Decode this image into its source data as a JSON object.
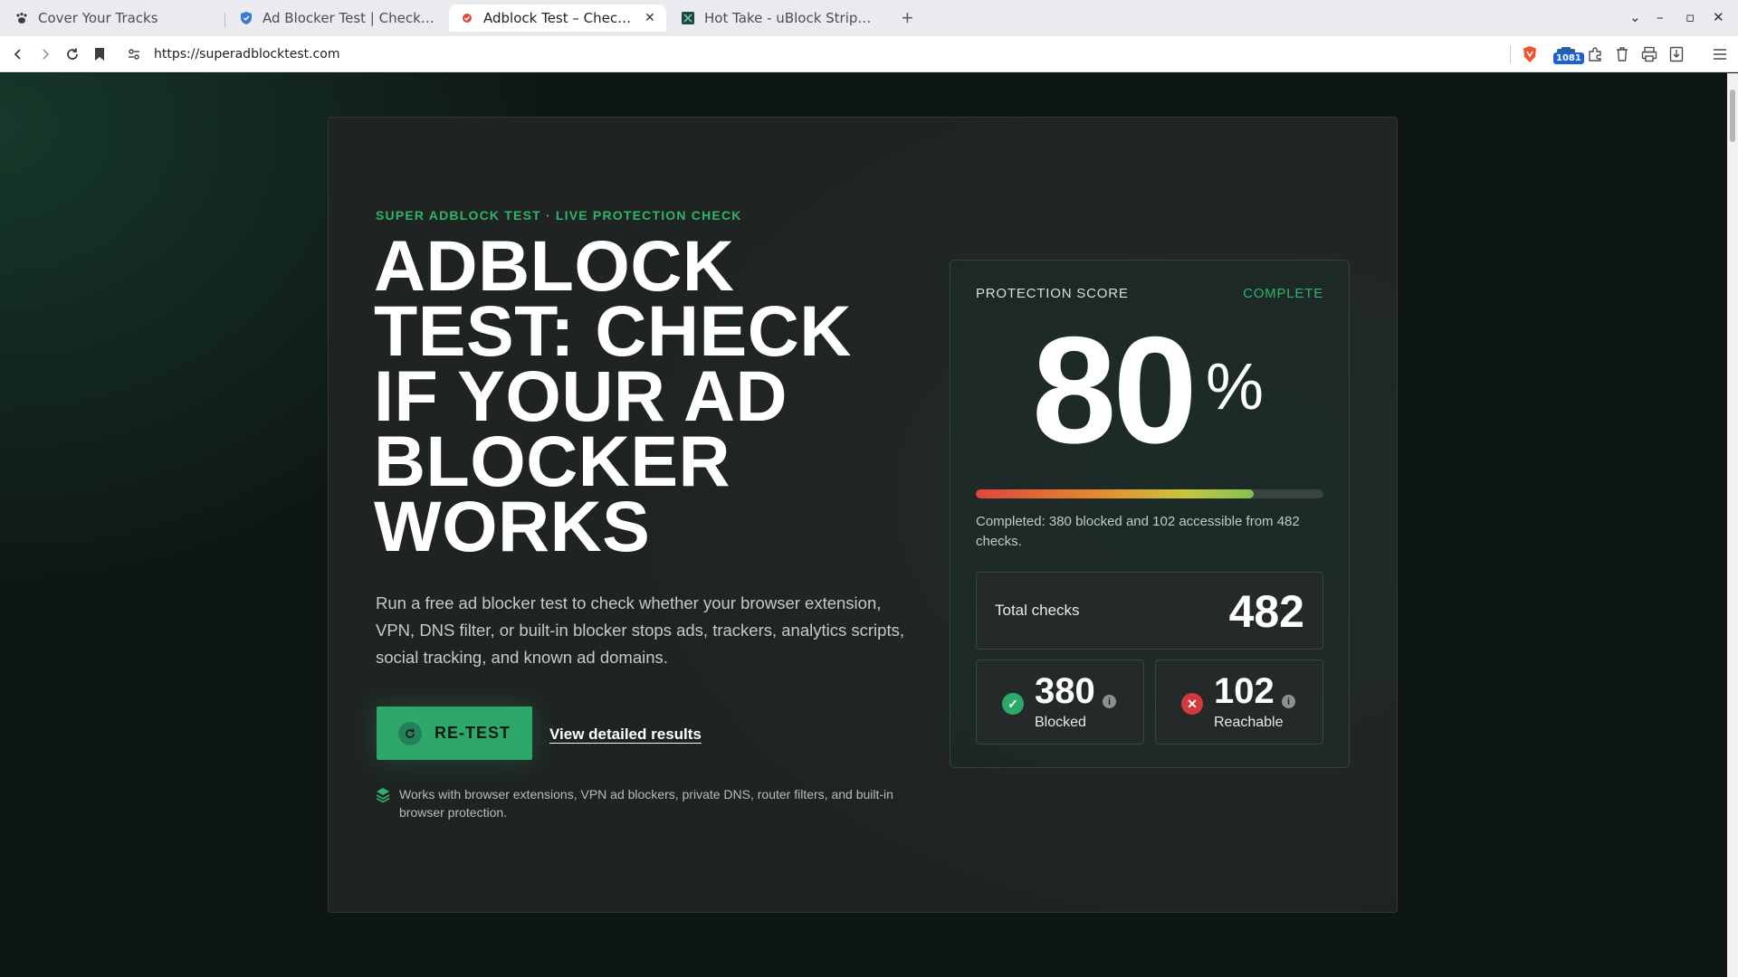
{
  "browser": {
    "tabs": [
      {
        "title": "Cover Your Tracks",
        "active": false
      },
      {
        "title": "Ad Blocker Test | Check if Y",
        "active": false
      },
      {
        "title": "Adblock Test – Check If Y",
        "active": true
      },
      {
        "title": "Hot Take - uBlock Stripped",
        "active": false
      }
    ],
    "new_tab_label": "+",
    "url": "https://superadblocktest.com",
    "extension_badge": "1081",
    "accent_color": "#1a62d6"
  },
  "hero": {
    "eyebrow": "SUPER ADBLOCK TEST · LIVE PROTECTION CHECK",
    "headline": "ADBLOCK TEST: CHECK IF YOUR AD BLOCKER WORKS",
    "description": "Run a free ad blocker test to check whether your browser extension, VPN, DNS filter, or built-in blocker stops ads, trackers, analytics scripts, social tracking, and known ad domains.",
    "retest_label": "RE-TEST",
    "details_link": "View detailed results",
    "works_with": "Works with browser extensions, VPN ad blockers, private DNS, router filters, and built-in browser protection.",
    "accent_color": "#2ea86a"
  },
  "score": {
    "label": "PROTECTION SCORE",
    "status": "COMPLETE",
    "value": "80",
    "unit": "%",
    "progress_fraction": 0.8,
    "summary": "Completed: 380 blocked and 102 accessible from 482 checks.",
    "total_label": "Total checks",
    "total_value": "482",
    "blocked_value": "380",
    "blocked_label": "Blocked",
    "reachable_value": "102",
    "reachable_label": "Reachable",
    "blocked_color": "#2ea86a",
    "reachable_color": "#d23a3a"
  }
}
